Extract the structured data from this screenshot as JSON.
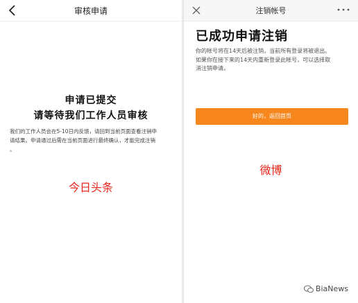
{
  "left_screen": {
    "nav_title": "审核申请",
    "status_line1": "申请已提交",
    "status_line2": "请等待我们工作人员审核",
    "description_lines": [
      "我们的工作人员会在5-10日内反馈，请回到当前页面查看注销申",
      "请结果。申请通过后需在当前页面进行最终确认，才能完成注销",
      "。"
    ],
    "caption": "今日头条",
    "caption_color": "#e8251a"
  },
  "right_screen": {
    "nav_title": "注销帐号",
    "title": "已成功申请注销",
    "info_lines": [
      "你的帐号将在14天后被注销，当前所有登录将被退出。",
      "如果你在接下来的14天内重新登录此帐号，可以选择取",
      "消注销申请。"
    ],
    "button_label": "好的，返回首页",
    "button_color": "#f7861d",
    "caption": "微博"
  },
  "watermark": {
    "text": "BiaNews",
    "icon": "wechat-icon"
  }
}
